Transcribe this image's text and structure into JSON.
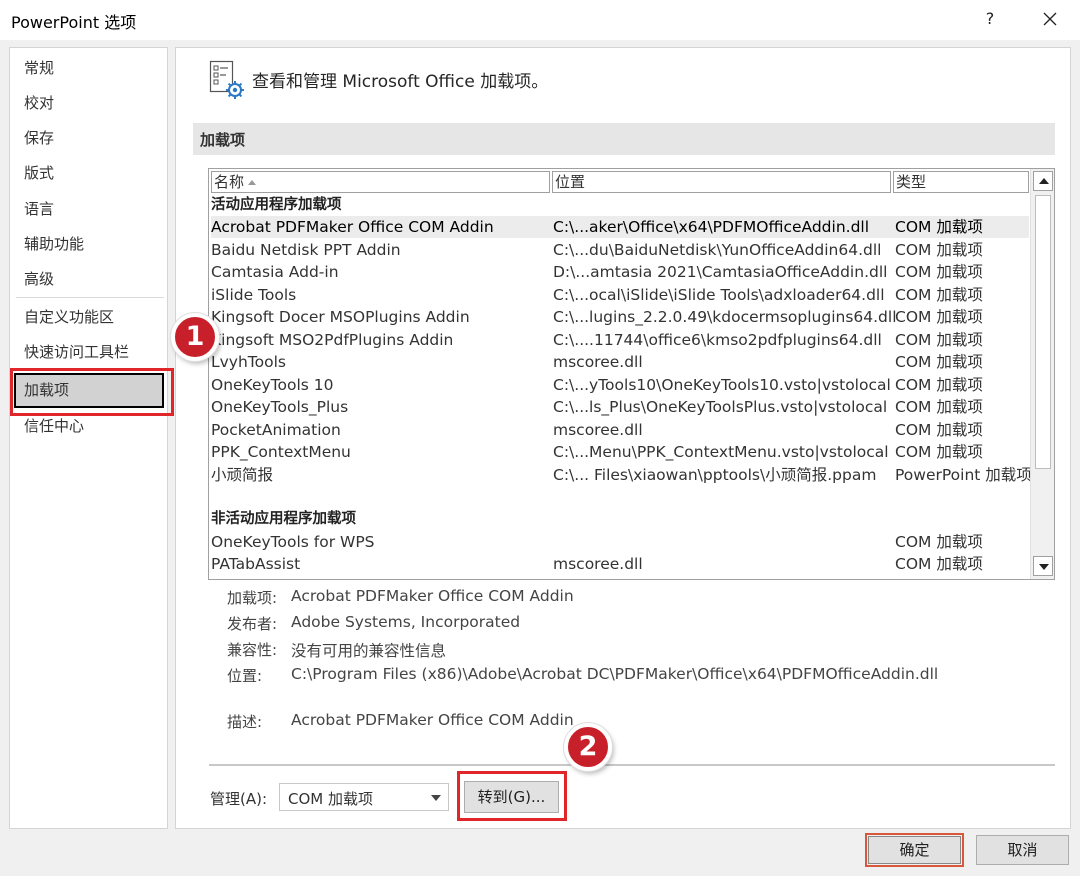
{
  "window": {
    "title": "PowerPoint 选项",
    "help": "?"
  },
  "nav": {
    "items": [
      "常规",
      "校对",
      "保存",
      "版式",
      "语言",
      "辅助功能",
      "高级",
      "自定义功能区",
      "快速访问工具栏",
      "加载项",
      "信任中心"
    ],
    "selected": "加载项"
  },
  "header": {
    "text": "查看和管理 Microsoft Office 加载项。"
  },
  "section": {
    "title": "加载项"
  },
  "table": {
    "columns": [
      "名称",
      "位置",
      "类型"
    ],
    "active_group": "活动应用程序加载项",
    "active_rows": [
      [
        "Acrobat PDFMaker Office COM Addin",
        "C:\\...aker\\Office\\x64\\PDFMOfficeAddin.dll",
        "COM 加载项"
      ],
      [
        "Baidu Netdisk PPT Addin",
        "C:\\...du\\BaiduNetdisk\\YunOfficeAddin64.dll",
        "COM 加载项"
      ],
      [
        "Camtasia Add-in",
        "D:\\...amtasia 2021\\CamtasiaOfficeAddin.dll",
        "COM 加载项"
      ],
      [
        "iSlide Tools",
        "C:\\...ocal\\iSlide\\iSlide Tools\\adxloader64.dll",
        "COM 加载项"
      ],
      [
        "Kingsoft Docer MSOPlugins Addin",
        "C:\\...lugins_2.2.0.49\\kdocermsoplugins64.dll",
        "COM 加载项"
      ],
      [
        "Kingsoft MSO2PdfPlugins Addin",
        "C:\\....11744\\office6\\kmso2pdfplugins64.dll",
        "COM 加载项"
      ],
      [
        "LvyhTools",
        "mscoree.dll",
        "COM 加载项"
      ],
      [
        "OneKeyTools 10",
        "C:\\...yTools10\\OneKeyTools10.vsto|vstolocal",
        "COM 加载项"
      ],
      [
        "OneKeyTools_Plus",
        "C:\\...ls_Plus\\OneKeyToolsPlus.vsto|vstolocal",
        "COM 加载项"
      ],
      [
        "PocketAnimation",
        "mscoree.dll",
        "COM 加载项"
      ],
      [
        "PPK_ContextMenu",
        "C:\\...Menu\\PPK_ContextMenu.vsto|vstolocal",
        "COM 加载项"
      ],
      [
        "小顽简报",
        "C:\\... Files\\xiaowan\\pptools\\小顽简报.ppam",
        "PowerPoint 加载项"
      ]
    ],
    "inactive_group": "非活动应用程序加载项",
    "inactive_rows": [
      [
        "OneKeyTools for WPS",
        "",
        "COM 加载项"
      ],
      [
        "PATabAssist",
        "mscoree.dll",
        "COM 加载项"
      ]
    ]
  },
  "detail": {
    "addin_label": "加载项:",
    "addin_value": "Acrobat PDFMaker Office COM Addin",
    "publisher_label": "发布者:",
    "publisher_value": "Adobe Systems, Incorporated",
    "compat_label": "兼容性:",
    "compat_value": "没有可用的兼容性信息",
    "location_label": "位置:",
    "location_value": "C:\\Program Files (x86)\\Adobe\\Acrobat DC\\PDFMaker\\Office\\x64\\PDFMOfficeAddin.dll",
    "desc_label": "描述:",
    "desc_value": "Acrobat PDFMaker Office COM Addin"
  },
  "manage": {
    "label": "管理(A):",
    "selected": "COM 加载项",
    "goto_label": "转到(G)..."
  },
  "badges": {
    "first": "1",
    "second": "2"
  },
  "buttons": {
    "ok": "确定",
    "cancel": "取消"
  },
  "colors": {
    "highlight_red": "#e0262a",
    "badge_red": "#c8202a",
    "selected_row": "#ececec"
  }
}
